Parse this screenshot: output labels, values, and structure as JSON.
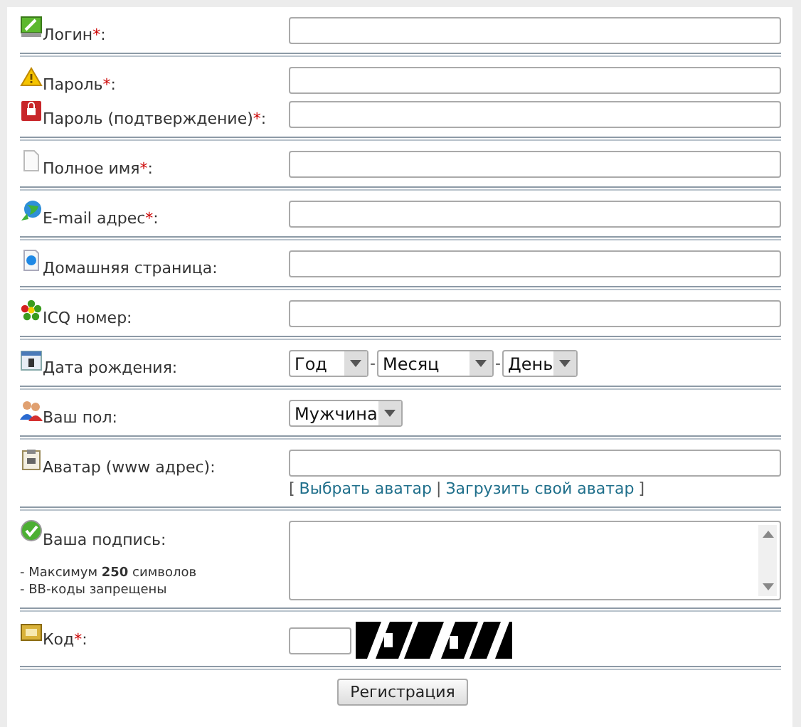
{
  "sections": [
    {
      "kind": "text",
      "fields": [
        {
          "label": "Логин",
          "required_mark": "*",
          "colon": ":"
        }
      ]
    },
    {
      "kind": "text",
      "fields": [
        {
          "label": "Пароль",
          "required_mark": "*",
          "colon": ":"
        },
        {
          "label": "Пароль (подтверждение)",
          "required_mark": "*",
          "colon": ":"
        }
      ]
    },
    {
      "kind": "text",
      "fields": [
        {
          "label": "Полное имя",
          "required_mark": "*",
          "colon": ":"
        }
      ]
    },
    {
      "kind": "text",
      "fields": [
        {
          "label": "E-mail адрес",
          "required_mark": "*",
          "colon": ":"
        }
      ]
    },
    {
      "kind": "text",
      "fields": [
        {
          "label": "Домашняя страница:"
        }
      ]
    },
    {
      "kind": "text",
      "fields": [
        {
          "label": "ICQ номер:"
        }
      ]
    },
    {
      "kind": "selects",
      "fields": [
        {
          "label": "Дата рождения:",
          "selects": [
            "Год",
            "Месяц",
            "День"
          ],
          "separator": "-"
        }
      ]
    },
    {
      "kind": "selects",
      "fields": [
        {
          "label": "Ваш пол:",
          "selects": [
            "Мужчина"
          ]
        }
      ]
    },
    {
      "kind": "avatar",
      "fields": [
        {
          "label": "Аватар (www адрес):",
          "links": [
            "Выбрать аватар",
            "Загрузить свой аватар"
          ],
          "open": "[",
          "bar": "|",
          "close": "]"
        }
      ]
    },
    {
      "kind": "textarea",
      "fields": [
        {
          "label": "Ваша подпись:",
          "notes": [
            "- Максимум **250** символов",
            "- BB-коды запрещены"
          ]
        }
      ]
    },
    {
      "kind": "captcha",
      "fields": [
        {
          "label": "Код",
          "required_mark": "*",
          "colon": ":"
        }
      ]
    }
  ],
  "submit": "Регистрация"
}
